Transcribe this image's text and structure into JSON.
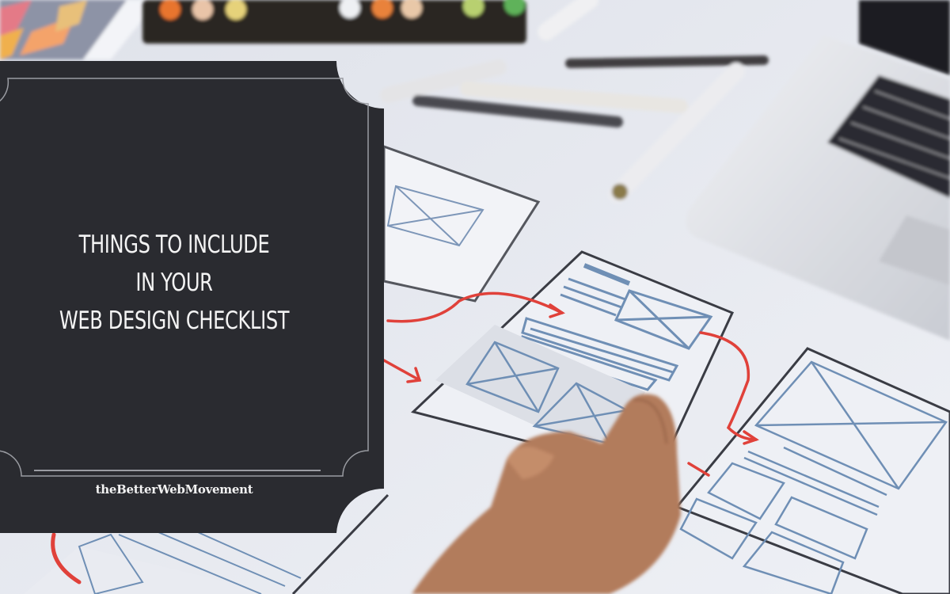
{
  "image": {
    "description": "Featured blog header image: wireframe sketches, markers and laptop on a desk with a dark title panel",
    "colors": {
      "panel_bg": "#2a2b30",
      "panel_text": "#f4f4f4",
      "frame_line": "#9a9ca2",
      "paper": "#e8eaf0",
      "sketch_blue": "#6f8fb5",
      "sketch_dark": "#3a3c44",
      "arrow_red": "#e0413a",
      "skin": "#b07a5a"
    }
  },
  "panel": {
    "title_lines": [
      "THINGS TO INCLUDE",
      "IN YOUR",
      "WEB DESIGN CHECKLIST"
    ],
    "brand": "theBetterWebMovement"
  },
  "photo": {
    "objects": [
      "marker-tray",
      "markers",
      "laptop",
      "wireframe-sheets",
      "red-flow-arrows",
      "hand-holding-card"
    ]
  }
}
